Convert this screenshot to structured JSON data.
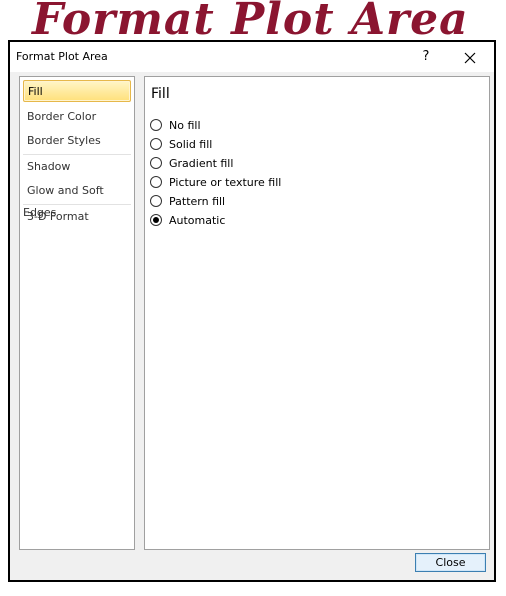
{
  "banner": {
    "text": "Format Plot Area"
  },
  "dialog": {
    "title": "Format Plot Area",
    "help_label": "?",
    "close_button_label": "Close"
  },
  "sidebar": {
    "items": [
      {
        "label": "Fill",
        "selected": true
      },
      {
        "label": "Border Color"
      },
      {
        "label": "Border Styles"
      },
      {
        "label": "Shadow"
      },
      {
        "label": "Glow and Soft Edges"
      },
      {
        "label": "3-D Format"
      }
    ]
  },
  "panel": {
    "heading": "Fill",
    "options": [
      {
        "label": "No fill",
        "checked": false
      },
      {
        "label": "Solid fill",
        "checked": false
      },
      {
        "label": "Gradient fill",
        "checked": false
      },
      {
        "label": "Picture or texture fill",
        "checked": false
      },
      {
        "label": "Pattern fill",
        "checked": false
      },
      {
        "label": "Automatic",
        "checked": true
      }
    ]
  },
  "colors": {
    "banner": "#8b1530",
    "selected_item": "#ffe07a",
    "default_button_border": "#3c7fb1"
  }
}
